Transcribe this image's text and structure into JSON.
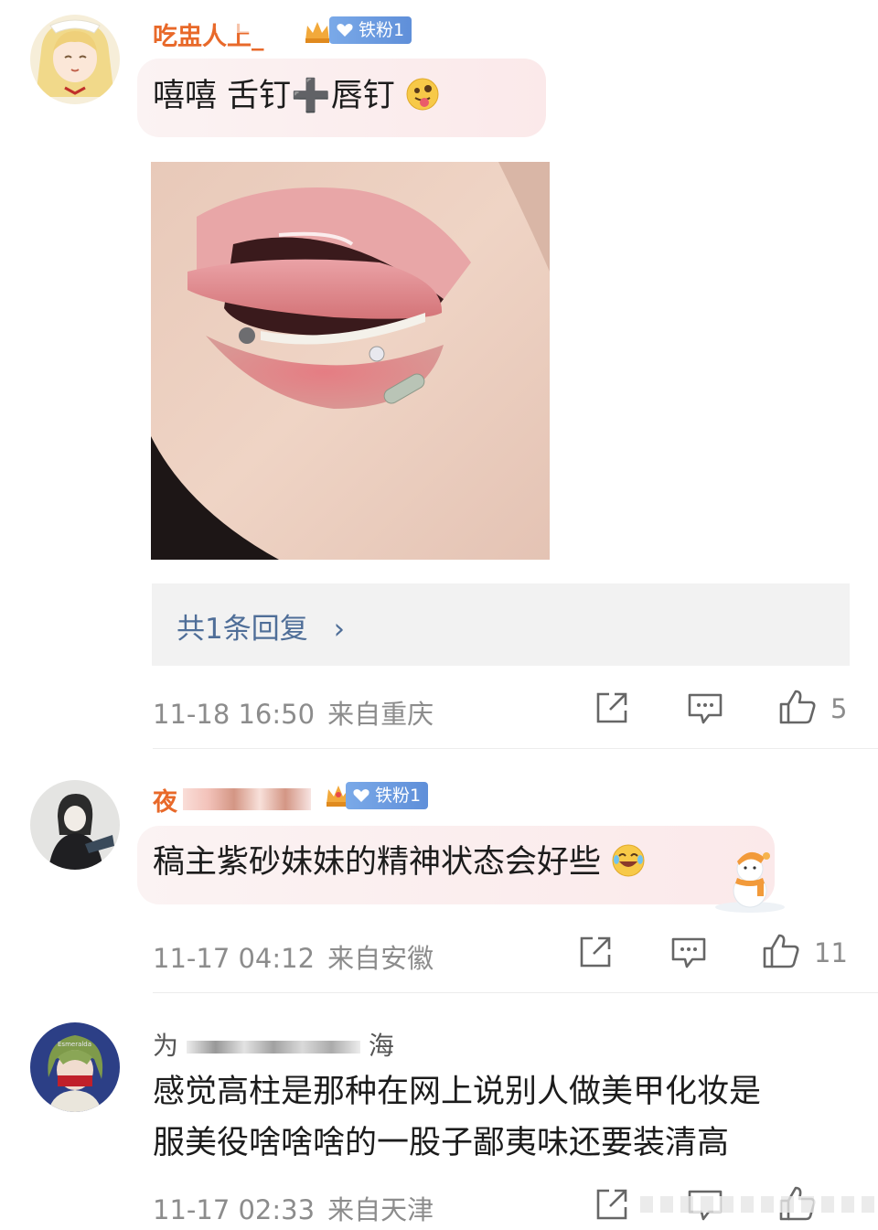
{
  "comments": [
    {
      "username": "吃盅人上_",
      "fan_badge": "铁粉1",
      "text": "嘻嘻 舌钉➕唇钉",
      "emoji": "tongue-face",
      "has_image": true,
      "replies_label": "共1条回复",
      "time": "11-18 16:50",
      "location": "来自重庆",
      "likes": "5"
    },
    {
      "username": "夜",
      "fan_badge": "铁粉1",
      "text": "稿主紫砂妹妹的精神状态会好些",
      "emoji": "laugh-tears",
      "time": "11-17 04:12",
      "location": "来自安徽",
      "likes": "11"
    },
    {
      "username": "为",
      "username_tail": "海",
      "text_line1": "感觉高柱是那种在网上说别人做美甲化妆是",
      "text_line2": "服美役啥啥啥的一股子鄙夷味还要装清高",
      "avatar_text": "Esmeralda",
      "time": "11-17 02:33",
      "location": "来自天津"
    }
  ],
  "colors": {
    "username_orange": "#e8692a",
    "badge_blue": "#6a9be0",
    "reply_link": "#4f6e98",
    "meta_gray": "#8c8c8c",
    "bubble_pink": "#fbe9ea"
  }
}
